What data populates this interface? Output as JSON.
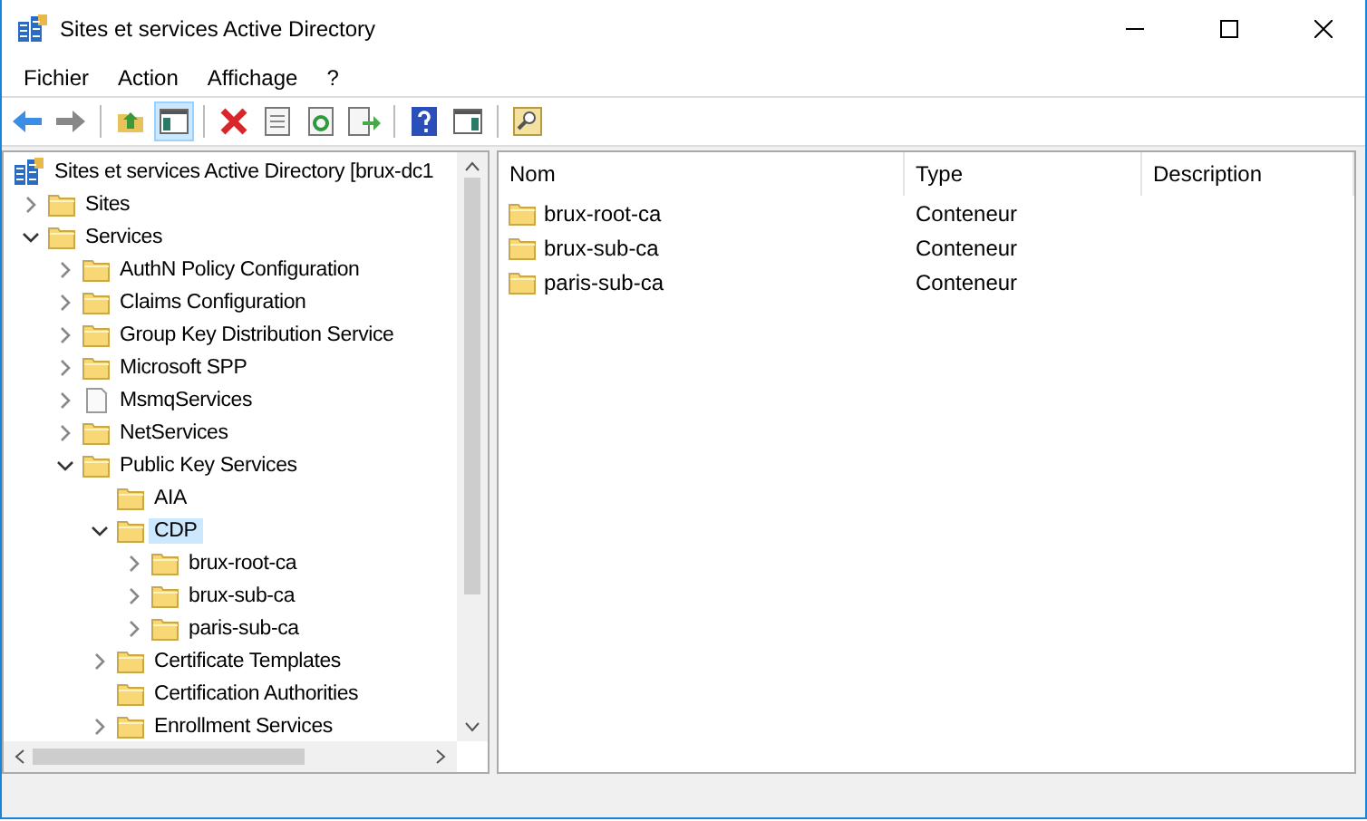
{
  "window": {
    "title": "Sites et services Active Directory"
  },
  "menu": [
    "Fichier",
    "Action",
    "Affichage",
    "?"
  ],
  "toolbar": {
    "show_tree_pressed": true
  },
  "tree": [
    {
      "label": "Sites et services Active Directory [brux-dc1",
      "kind": "root",
      "selected": false,
      "children": [
        {
          "label": "Sites",
          "kind": "folder",
          "expandable": true,
          "expanded": false,
          "selected": false
        },
        {
          "label": "Services",
          "kind": "folder",
          "expandable": true,
          "expanded": true,
          "selected": false,
          "children": [
            {
              "label": "AuthN Policy Configuration",
              "kind": "folder",
              "expandable": true,
              "expanded": false,
              "selected": false
            },
            {
              "label": "Claims Configuration",
              "kind": "folder",
              "expandable": true,
              "expanded": false,
              "selected": false
            },
            {
              "label": "Group Key Distribution Service",
              "kind": "folder",
              "expandable": true,
              "expanded": false,
              "selected": false
            },
            {
              "label": "Microsoft SPP",
              "kind": "folder",
              "expandable": true,
              "expanded": false,
              "selected": false
            },
            {
              "label": "MsmqServices",
              "kind": "file",
              "expandable": true,
              "expanded": false,
              "selected": false
            },
            {
              "label": "NetServices",
              "kind": "folder",
              "expandable": true,
              "expanded": false,
              "selected": false
            },
            {
              "label": "Public Key Services",
              "kind": "folder",
              "expandable": true,
              "expanded": true,
              "selected": false,
              "children": [
                {
                  "label": "AIA",
                  "kind": "folder",
                  "expandable": false,
                  "selected": false
                },
                {
                  "label": "CDP",
                  "kind": "folder",
                  "expandable": true,
                  "expanded": true,
                  "selected": true,
                  "children": [
                    {
                      "label": "brux-root-ca",
                      "kind": "folder",
                      "expandable": true,
                      "expanded": false,
                      "selected": false
                    },
                    {
                      "label": "brux-sub-ca",
                      "kind": "folder",
                      "expandable": true,
                      "expanded": false,
                      "selected": false
                    },
                    {
                      "label": "paris-sub-ca",
                      "kind": "folder",
                      "expandable": true,
                      "expanded": false,
                      "selected": false
                    }
                  ]
                },
                {
                  "label": "Certificate Templates",
                  "kind": "folder",
                  "expandable": true,
                  "expanded": false,
                  "selected": false
                },
                {
                  "label": "Certification Authorities",
                  "kind": "folder",
                  "expandable": false,
                  "selected": false
                },
                {
                  "label": "Enrollment Services",
                  "kind": "folder",
                  "expandable": true,
                  "expanded": false,
                  "selected": false
                }
              ]
            }
          ]
        }
      ]
    }
  ],
  "list": {
    "columns": [
      "Nom",
      "Type",
      "Description"
    ],
    "rows": [
      {
        "name": "brux-root-ca",
        "type": "Conteneur"
      },
      {
        "name": "brux-sub-ca",
        "type": "Conteneur"
      },
      {
        "name": "paris-sub-ca",
        "type": "Conteneur"
      }
    ]
  }
}
